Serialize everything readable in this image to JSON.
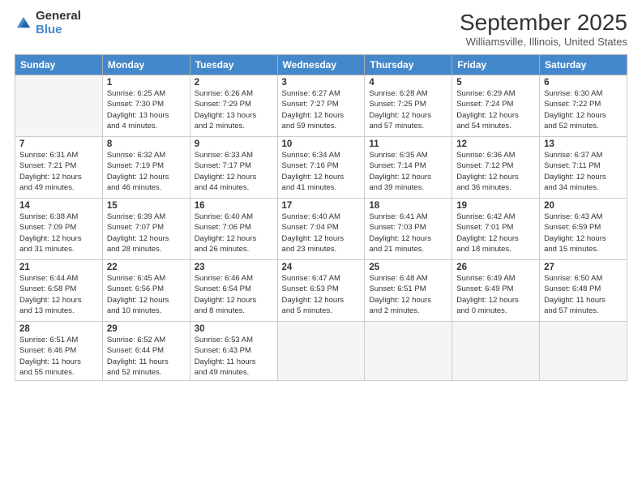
{
  "logo": {
    "general": "General",
    "blue": "Blue"
  },
  "header": {
    "month": "September 2025",
    "location": "Williamsville, Illinois, United States"
  },
  "days_of_week": [
    "Sunday",
    "Monday",
    "Tuesday",
    "Wednesday",
    "Thursday",
    "Friday",
    "Saturday"
  ],
  "weeks": [
    [
      {
        "num": "",
        "info": ""
      },
      {
        "num": "1",
        "info": "Sunrise: 6:25 AM\nSunset: 7:30 PM\nDaylight: 13 hours\nand 4 minutes."
      },
      {
        "num": "2",
        "info": "Sunrise: 6:26 AM\nSunset: 7:29 PM\nDaylight: 13 hours\nand 2 minutes."
      },
      {
        "num": "3",
        "info": "Sunrise: 6:27 AM\nSunset: 7:27 PM\nDaylight: 12 hours\nand 59 minutes."
      },
      {
        "num": "4",
        "info": "Sunrise: 6:28 AM\nSunset: 7:25 PM\nDaylight: 12 hours\nand 57 minutes."
      },
      {
        "num": "5",
        "info": "Sunrise: 6:29 AM\nSunset: 7:24 PM\nDaylight: 12 hours\nand 54 minutes."
      },
      {
        "num": "6",
        "info": "Sunrise: 6:30 AM\nSunset: 7:22 PM\nDaylight: 12 hours\nand 52 minutes."
      }
    ],
    [
      {
        "num": "7",
        "info": "Sunrise: 6:31 AM\nSunset: 7:21 PM\nDaylight: 12 hours\nand 49 minutes."
      },
      {
        "num": "8",
        "info": "Sunrise: 6:32 AM\nSunset: 7:19 PM\nDaylight: 12 hours\nand 46 minutes."
      },
      {
        "num": "9",
        "info": "Sunrise: 6:33 AM\nSunset: 7:17 PM\nDaylight: 12 hours\nand 44 minutes."
      },
      {
        "num": "10",
        "info": "Sunrise: 6:34 AM\nSunset: 7:16 PM\nDaylight: 12 hours\nand 41 minutes."
      },
      {
        "num": "11",
        "info": "Sunrise: 6:35 AM\nSunset: 7:14 PM\nDaylight: 12 hours\nand 39 minutes."
      },
      {
        "num": "12",
        "info": "Sunrise: 6:36 AM\nSunset: 7:12 PM\nDaylight: 12 hours\nand 36 minutes."
      },
      {
        "num": "13",
        "info": "Sunrise: 6:37 AM\nSunset: 7:11 PM\nDaylight: 12 hours\nand 34 minutes."
      }
    ],
    [
      {
        "num": "14",
        "info": "Sunrise: 6:38 AM\nSunset: 7:09 PM\nDaylight: 12 hours\nand 31 minutes."
      },
      {
        "num": "15",
        "info": "Sunrise: 6:39 AM\nSunset: 7:07 PM\nDaylight: 12 hours\nand 28 minutes."
      },
      {
        "num": "16",
        "info": "Sunrise: 6:40 AM\nSunset: 7:06 PM\nDaylight: 12 hours\nand 26 minutes."
      },
      {
        "num": "17",
        "info": "Sunrise: 6:40 AM\nSunset: 7:04 PM\nDaylight: 12 hours\nand 23 minutes."
      },
      {
        "num": "18",
        "info": "Sunrise: 6:41 AM\nSunset: 7:03 PM\nDaylight: 12 hours\nand 21 minutes."
      },
      {
        "num": "19",
        "info": "Sunrise: 6:42 AM\nSunset: 7:01 PM\nDaylight: 12 hours\nand 18 minutes."
      },
      {
        "num": "20",
        "info": "Sunrise: 6:43 AM\nSunset: 6:59 PM\nDaylight: 12 hours\nand 15 minutes."
      }
    ],
    [
      {
        "num": "21",
        "info": "Sunrise: 6:44 AM\nSunset: 6:58 PM\nDaylight: 12 hours\nand 13 minutes."
      },
      {
        "num": "22",
        "info": "Sunrise: 6:45 AM\nSunset: 6:56 PM\nDaylight: 12 hours\nand 10 minutes."
      },
      {
        "num": "23",
        "info": "Sunrise: 6:46 AM\nSunset: 6:54 PM\nDaylight: 12 hours\nand 8 minutes."
      },
      {
        "num": "24",
        "info": "Sunrise: 6:47 AM\nSunset: 6:53 PM\nDaylight: 12 hours\nand 5 minutes."
      },
      {
        "num": "25",
        "info": "Sunrise: 6:48 AM\nSunset: 6:51 PM\nDaylight: 12 hours\nand 2 minutes."
      },
      {
        "num": "26",
        "info": "Sunrise: 6:49 AM\nSunset: 6:49 PM\nDaylight: 12 hours\nand 0 minutes."
      },
      {
        "num": "27",
        "info": "Sunrise: 6:50 AM\nSunset: 6:48 PM\nDaylight: 11 hours\nand 57 minutes."
      }
    ],
    [
      {
        "num": "28",
        "info": "Sunrise: 6:51 AM\nSunset: 6:46 PM\nDaylight: 11 hours\nand 55 minutes."
      },
      {
        "num": "29",
        "info": "Sunrise: 6:52 AM\nSunset: 6:44 PM\nDaylight: 11 hours\nand 52 minutes."
      },
      {
        "num": "30",
        "info": "Sunrise: 6:53 AM\nSunset: 6:43 PM\nDaylight: 11 hours\nand 49 minutes."
      },
      {
        "num": "",
        "info": ""
      },
      {
        "num": "",
        "info": ""
      },
      {
        "num": "",
        "info": ""
      },
      {
        "num": "",
        "info": ""
      }
    ]
  ]
}
